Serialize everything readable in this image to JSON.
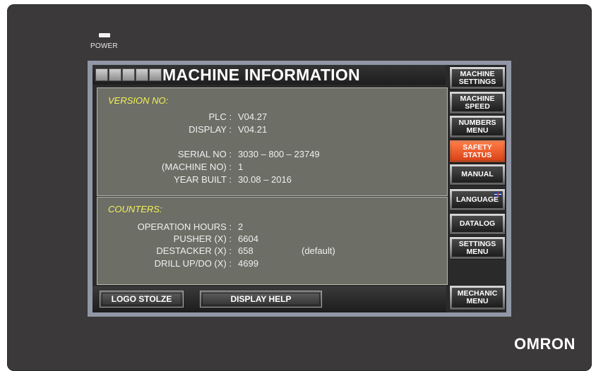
{
  "device": {
    "power_label": "POWER",
    "brand": "OMRON"
  },
  "screen": {
    "title": "MACHINE INFORMATION",
    "version": {
      "section_title": "VERSION NO:",
      "plc_label": "PLC :",
      "plc_value": "V04.27",
      "display_label": "DISPLAY :",
      "display_value": "V04.21",
      "serial_label": "SERIAL NO :",
      "serial_value": "3030 – 800  – 23749",
      "machine_no_label": "(MACHINE NO) :",
      "machine_no_value": "1",
      "year_label": "YEAR BUILT  :",
      "year_value": "30.08 – 2016"
    },
    "counters": {
      "section_title": "COUNTERS:",
      "rows": [
        {
          "label": "OPERATION HOURS :",
          "value": "2",
          "note": ""
        },
        {
          "label": "PUSHER (X) :",
          "value": "6604",
          "note": ""
        },
        {
          "label": "DESTACKER (X) :",
          "value": "658",
          "note": "(default)"
        },
        {
          "label": "DRILL UP/DO (X) :",
          "value": "4699",
          "note": ""
        }
      ]
    },
    "bottom_buttons": {
      "logo": "LOGO STOLZE",
      "help": "DISPLAY HELP"
    },
    "side_menu": [
      {
        "label": "MACHINE\nSETTINGS"
      },
      {
        "label": "MACHINE\nSPEED"
      },
      {
        "label": "NUMBERS\nMENU"
      },
      {
        "label": "SAFETY\nSTATUS"
      },
      {
        "label": "MANUAL"
      },
      {
        "label": "LANGUAGE"
      },
      {
        "label": "DATALOG"
      },
      {
        "label": "SETTINGS\nMENU"
      },
      {
        "label": "MECHANIC\nMENU"
      }
    ],
    "active_menu": "SAFETY\nSTATUS"
  }
}
